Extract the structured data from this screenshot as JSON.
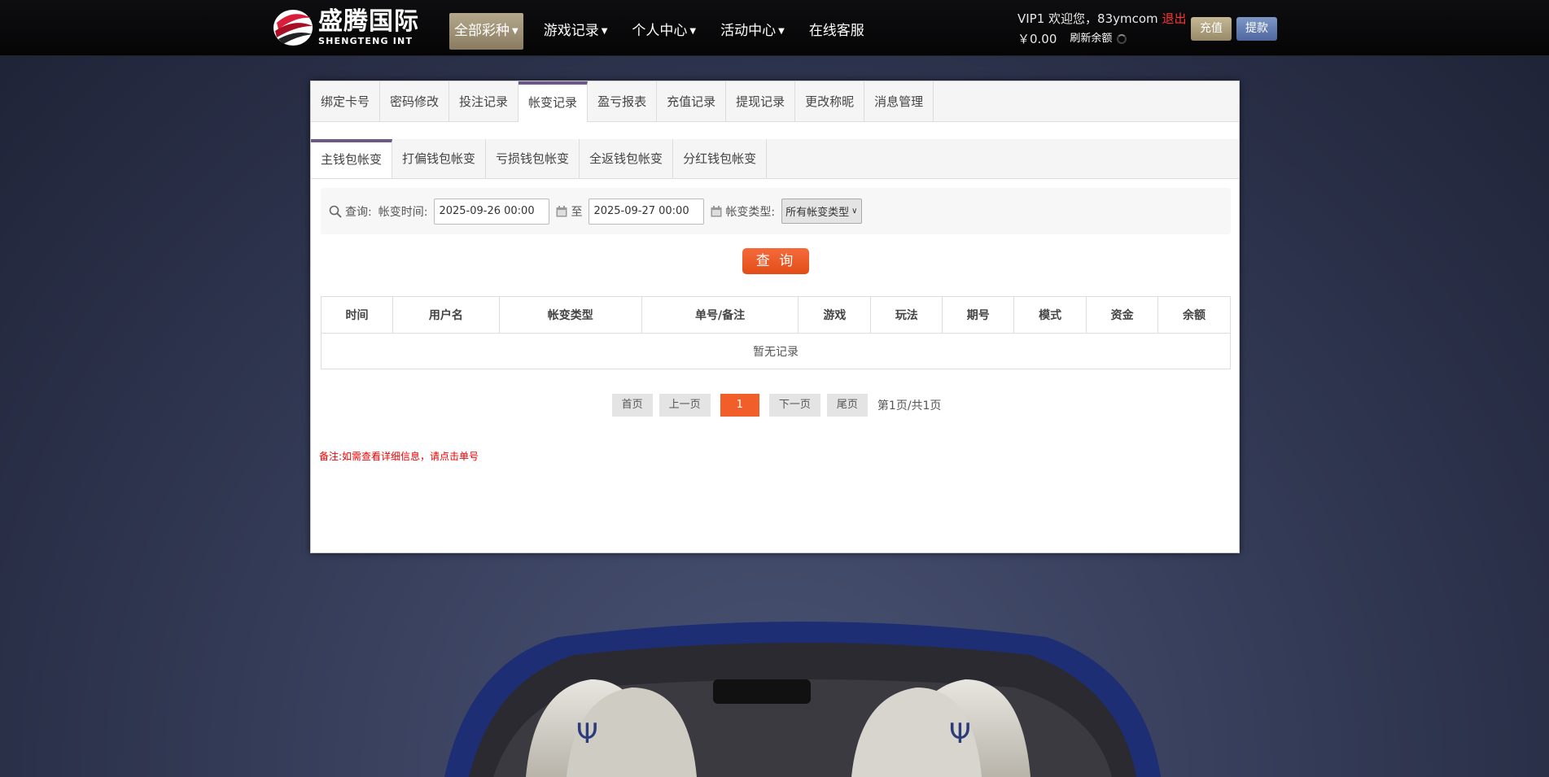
{
  "header": {
    "logo_cn": "盛腾国际",
    "logo_en": "SHENGTENG INT",
    "nav": [
      {
        "label": "全部彩种",
        "caret": true,
        "active": true
      },
      {
        "label": "游戏记录",
        "caret": true
      },
      {
        "label": "个人中心",
        "caret": true
      },
      {
        "label": "活动中心",
        "caret": true
      },
      {
        "label": "在线客服",
        "caret": false
      }
    ],
    "welcome": "VIP1 欢迎您，83ymcom",
    "logout": "退出",
    "balance": "￥0.00",
    "refresh": "刷新余额",
    "recharge": "充值",
    "withdraw": "提款"
  },
  "tabs1": [
    "绑定卡号",
    "密码修改",
    "投注记录",
    "帐变记录",
    "盈亏报表",
    "充值记录",
    "提现记录",
    "更改称昵",
    "消息管理"
  ],
  "tabs1_active": 3,
  "tabs2": [
    "主钱包帐变",
    "打偏钱包帐变",
    "亏损钱包帐变",
    "全返钱包帐变",
    "分红钱包帐变"
  ],
  "tabs2_active": 0,
  "query": {
    "label": "查询:",
    "time_label": "帐变时间:",
    "start": "2025-09-26 00:00",
    "to": "至",
    "end": "2025-09-27 00:00",
    "type_label": "帐变类型:",
    "type_value": "所有帐变类型",
    "button": "查 询"
  },
  "table": {
    "columns": [
      "时间",
      "用户名",
      "帐变类型",
      "单号/备注",
      "游戏",
      "玩法",
      "期号",
      "模式",
      "资金",
      "余额"
    ],
    "empty": "暂无记录"
  },
  "pager": {
    "first": "首页",
    "prev": "上一页",
    "current": "1",
    "next": "下一页",
    "last": "尾页",
    "info": "第1页/共1页"
  },
  "note": "备注:如需查看详细信息，请点击单号",
  "colors": {
    "accent": "#f25e2a",
    "tab_active": "#6c5a86",
    "note": "#ee0000"
  }
}
